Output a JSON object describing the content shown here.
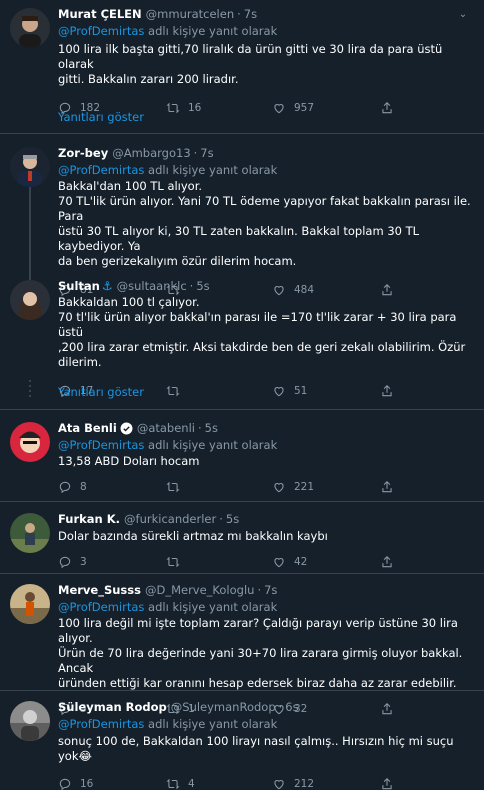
{
  "tweets": [
    {
      "name": "Murat ÇELEN",
      "handle": "@mmuratcelen",
      "time": "7s",
      "reply_prefix": "",
      "reply_mention": "",
      "reply_suffix": "",
      "lines": [
        "100 lira ilk başta gitti,70 liralık da ürün gitti ve 30 lira da para üstü olarak",
        "gitti. Bakkalın zararı 200 liradır."
      ],
      "replies": "182",
      "retweets": "16",
      "likes": "957"
    },
    {
      "name": "Zor-bey",
      "handle": "@Ambargo13",
      "time": "7s",
      "reply_prefix": "",
      "reply_mention": "@ProfDemirtas",
      "reply_suffix": " adlı kişiye yanıt olarak",
      "lines": [
        "Bakkal'dan 100 TL alıyor.",
        "70 TL'lik ürün alıyor. Yani 70 TL ödeme yapıyor fakat bakkalın parası ile. Para",
        "üstü 30 TL alıyor ki, 30 TL zaten bakkalın. Bakkal toplam 30 TL kaybediyor. Ya",
        "da ben gerizekalıyım özür dilerim hocam."
      ],
      "replies": "81",
      "retweets": "",
      "likes": "484"
    },
    {
      "name": "Sultan",
      "handle": "@sultaanklc",
      "time": "5s",
      "lines": [
        "Bakkaldan 100 tl çalıyor.",
        "70 tl'lik ürün alıyor bakkal'ın parası ile =170 tl'lik zarar + 30 lira para üstü",
        ",200 lira zarar etmiştir. Aksi takdirde ben de geri zekalı olabilirim. Özür",
        "dilerim."
      ],
      "replies": "17",
      "retweets": "",
      "likes": "51"
    },
    {
      "name": "Ata Benli",
      "handle": "@atabenli",
      "time": "5s",
      "reply_mention": "@ProfDemirtas",
      "reply_suffix": " adlı kişiye yanıt olarak",
      "lines": [
        "13,58 ABD Doları hocam"
      ],
      "replies": "8",
      "retweets": "",
      "likes": "221"
    },
    {
      "name": "Furkan K.",
      "handle": "@furkicanderler",
      "time": "5s",
      "lines": [
        "Dolar bazında sürekli artmaz mı bakkalın kaybı"
      ],
      "replies": "3",
      "retweets": "",
      "likes": "42"
    },
    {
      "name": "Merve_Susss",
      "handle": "@D_Merve_Kologlu",
      "time": "7s",
      "reply_mention": "@ProfDemirtas",
      "reply_suffix": " adlı kişiye yanıt olarak",
      "lines": [
        "100 lira değil mi işte toplam zarar? Çaldığı parayı verip üstüne 30 lira alıyor.",
        "Ürün de 70 lira değerinde yani 30+70 lira zarara girmiş oluyor bakkal. Ancak",
        "üründen ettiği kar oranını hesap edersek biraz daha az zarar edebilir."
      ],
      "replies": "3",
      "retweets": "1",
      "likes": "32"
    },
    {
      "name": "Süleyman Rodop",
      "handle": "@SuleymanRodop",
      "time": "6s",
      "reply_mention": "@ProfDemirtas",
      "reply_suffix": " adlı kişiye yanıt olarak",
      "lines": [
        "sonuç 100 de, Bakkaldan 100 lirayı nasıl çalmış.. Hırsızın hiç mi suçu yok😂"
      ],
      "replies": "16",
      "retweets": "4",
      "likes": "212"
    }
  ],
  "show_replies_label": "Yanıtları göster",
  "colors": {
    "background": "#15202b",
    "accent": "#1b95e0",
    "muted": "#8899a6",
    "border": "#38444d"
  }
}
